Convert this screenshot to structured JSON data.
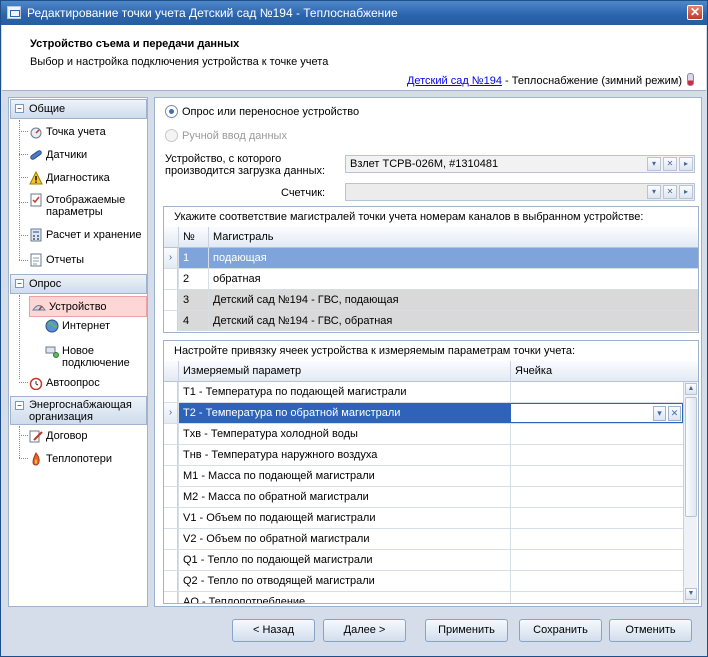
{
  "window": {
    "title": "Редактирование точки учета Детский сад №194 - Теплоснабжение",
    "close_glyph": "✕"
  },
  "header": {
    "title": "Устройство съема и передачи данных",
    "subtitle": "Выбор и настройка подключения устройства к точке учета",
    "link_text": "Детский сад №194",
    "link_suffix": " - Теплоснабжение (зимний режим)"
  },
  "sidebar": {
    "groups": [
      {
        "label": "Общие",
        "expander": "−"
      },
      {
        "label": "Опрос",
        "expander": "−"
      },
      {
        "label": "Энергоснабжающая организация",
        "expander": "−"
      }
    ],
    "items": {
      "tochka": "Точка учета",
      "datchiki": "Датчики",
      "diagnostika": "Диагностика",
      "params": "Отображаемые параметры",
      "raschet": "Расчет и хранение",
      "otchety": "Отчеты",
      "ustroistvo": "Устройство",
      "internet": "Интернет",
      "novoe": "Новое подключение",
      "avtoopros": "Автоопрос",
      "dogovor": "Договор",
      "teplopoteri": "Теплопотери"
    }
  },
  "main": {
    "radio_poll": "Опрос или переносное устройство",
    "radio_manual": "Ручной ввод данных",
    "device_label": "Устройство, с которого производится загрузка данных:",
    "device_value": "Взлет ТСРВ-026М, #1310481",
    "counter_label": "Счетчик:",
    "counter_value": "",
    "grid1": {
      "caption": "Укажите соответствие магистралей точки учета номерам каналов в выбранном устройстве:",
      "col_num": "№",
      "col_name": "Магистраль",
      "rows": [
        {
          "num": "1",
          "name": "подающая"
        },
        {
          "num": "2",
          "name": "обратная"
        },
        {
          "num": "3",
          "name": "Детский сад №194 - ГВС, подающая"
        },
        {
          "num": "4",
          "name": "Детский сад №194 - ГВС, обратная"
        }
      ]
    },
    "grid2": {
      "caption": "Настройте привязку ячеек устройства к измеряемым параметрам точки учета:",
      "col_param": "Измеряемый параметр",
      "col_cell": "Ячейка",
      "rows": [
        {
          "param": "T1 - Температура по подающей магистрали"
        },
        {
          "param": "T2 - Температура по обратной магистрали"
        },
        {
          "param": "Tхв - Температура холодной воды"
        },
        {
          "param": "Tнв - Температура наружного воздуха"
        },
        {
          "param": "M1 - Масса по подающей магистрали"
        },
        {
          "param": "M2 - Масса по обратной магистрали"
        },
        {
          "param": "V1 - Объем по подающей магистрали"
        },
        {
          "param": "V2 - Объем по обратной магистрали"
        },
        {
          "param": "Q1 - Тепло по подающей магистрали"
        },
        {
          "param": "Q2 - Тепло по отводящей магистрали"
        },
        {
          "param": "AQ - Теплопотребление"
        }
      ]
    }
  },
  "footer": {
    "back": "< Назад",
    "next": "Далее >",
    "apply": "Применить",
    "save": "Сохранить",
    "cancel": "Отменить"
  },
  "colors": {
    "accent": "#2d63b8",
    "row_highlight": "#7ea4db",
    "selected_item": "#ffd6d6"
  }
}
